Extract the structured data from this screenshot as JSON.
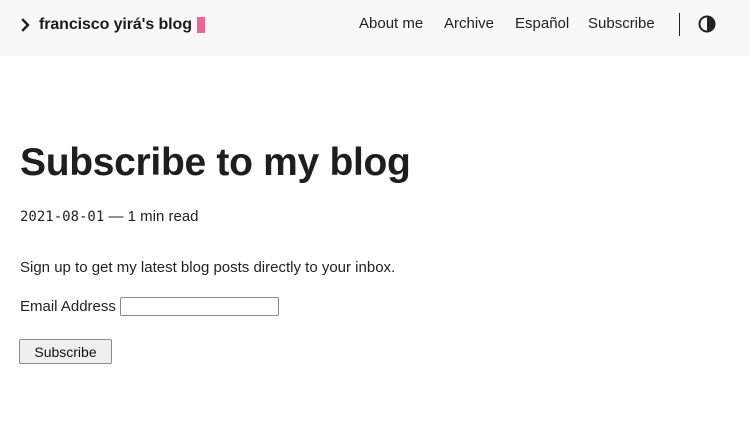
{
  "header": {
    "brand_title": "francisco yirá's blog",
    "brand_accent_color": "#f06292",
    "nav": [
      {
        "label": "About me"
      },
      {
        "label": "Archive"
      },
      {
        "label": "Español"
      },
      {
        "label": "Subscribe"
      }
    ],
    "theme_toggle_icon": "contrast-icon"
  },
  "post": {
    "title": "Subscribe to my blog",
    "date": "2021-08-01",
    "separator": "—",
    "read_time": "1 min read",
    "intro": "Sign up to get my latest blog posts directly to your inbox."
  },
  "form": {
    "email_label": "Email Address",
    "email_value": "",
    "submit_label": "Subscribe"
  }
}
